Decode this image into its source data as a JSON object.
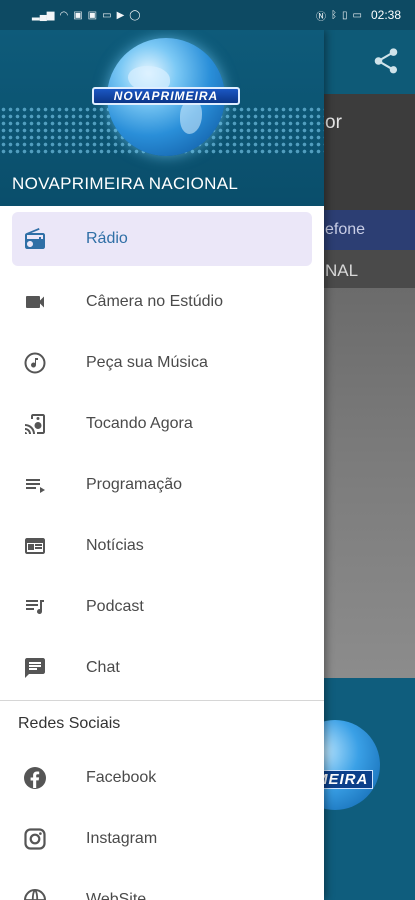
{
  "status_bar": {
    "time": "02:38"
  },
  "background": {
    "header_partial": "or",
    "fone_partial": "efone",
    "nacional_partial": "NAL",
    "logo_partial": "MEIRA"
  },
  "drawer": {
    "logo_text": "NOVAPRIMEIRA",
    "app_name": "NOVAPRIMEIRA NACIONAL",
    "items": [
      {
        "label": "Rádio",
        "icon": "radio-icon",
        "active": true
      },
      {
        "label": "Câmera no Estúdio",
        "icon": "videocam-icon"
      },
      {
        "label": "Peça sua Música",
        "icon": "music-note-icon"
      },
      {
        "label": "Tocando Agora",
        "icon": "speaker-cast-icon"
      },
      {
        "label": "Programação",
        "icon": "playlist-play-icon"
      },
      {
        "label": "Notícias",
        "icon": "news-icon"
      },
      {
        "label": "Podcast",
        "icon": "podcast-queue-icon"
      },
      {
        "label": "Chat",
        "icon": "chat-icon"
      }
    ],
    "social_section_title": "Redes Sociais",
    "social_items": [
      {
        "label": "Facebook",
        "icon": "facebook-icon"
      },
      {
        "label": "Instagram",
        "icon": "instagram-icon"
      },
      {
        "label": "WebSite",
        "icon": "globe-icon"
      }
    ]
  },
  "colors": {
    "accent": "#2f6fa6",
    "drawer_header": "#0e5b7a",
    "active_bg": "#ebe7f8"
  }
}
